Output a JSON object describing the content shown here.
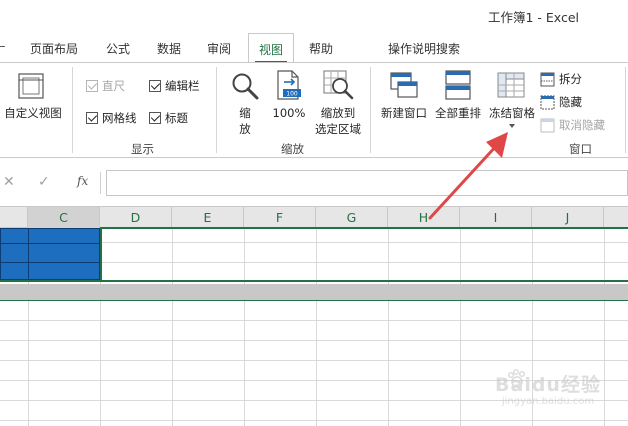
{
  "window": {
    "title": "工作簿1  -  Excel"
  },
  "tabs": [
    {
      "label": "页面布局"
    },
    {
      "label": "公式"
    },
    {
      "label": "数据"
    },
    {
      "label": "审阅"
    },
    {
      "label": "视图"
    },
    {
      "label": "帮助"
    },
    {
      "label": "操作说明搜索"
    }
  ],
  "ribbon": {
    "workbook_views": {
      "custom_view_label": "自定义视图"
    },
    "show": {
      "group_label": "显示",
      "ruler": {
        "label": "直尺",
        "checked": true,
        "disabled": true
      },
      "formula_bar": {
        "label": "编辑栏",
        "checked": true
      },
      "gridlines": {
        "label": "网格线",
        "checked": true
      },
      "headings": {
        "label": "标题",
        "checked": true
      }
    },
    "zoom": {
      "group_label": "缩放",
      "zoom_label_1": "缩",
      "zoom_label_2": "放",
      "zoom100_label": "100%",
      "zoom100_icon_text": "100",
      "zoom_selection_label_1": "缩放到",
      "zoom_selection_label_2": "选定区域"
    },
    "window": {
      "group_label": "窗口",
      "new_window_label": "新建窗口",
      "arrange_all_label": "全部重排",
      "freeze_panes_label": "冻结窗格",
      "split_label": "拆分",
      "hide_label": "隐藏",
      "unhide_label": "取消隐藏"
    }
  },
  "formula_bar": {
    "cancel_icon": "✕",
    "enter_icon": "✓",
    "fx_label": "fx",
    "value": ""
  },
  "grid": {
    "columns": [
      "C",
      "D",
      "E",
      "F",
      "G",
      "H",
      "I",
      "J"
    ],
    "selected_columns": [
      "C"
    ]
  },
  "colors": {
    "accent_green": "#217346",
    "selection_blue": "#1e6ec0",
    "annotation_red": "#e04848"
  },
  "watermark": {
    "text": "Baidu经验",
    "subtext": "jingyan.baidu.com"
  }
}
